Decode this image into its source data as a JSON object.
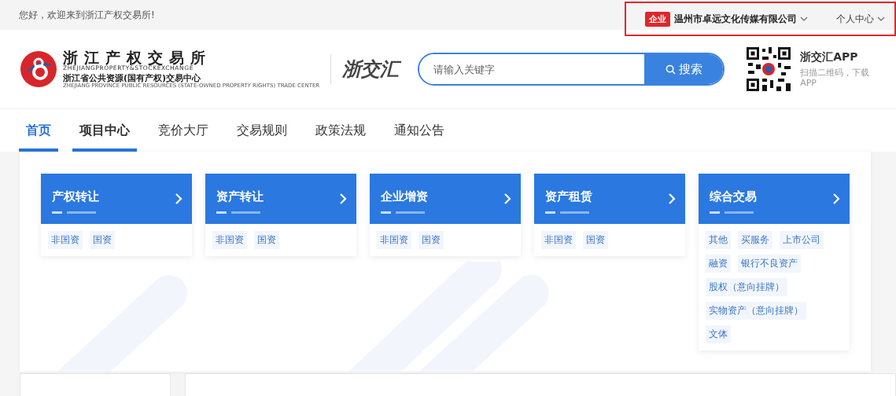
{
  "top_bar": {
    "greeting": "您好，欢迎来到浙江产权交易所!",
    "account_badge": "企业",
    "company": "温州市卓远文化传媒有限公司",
    "personal_center": "个人中心",
    "highlighted": true
  },
  "header": {
    "logo_title": "浙江产权交易所",
    "logo_en": "ZHEJIANGPROPERTY&STOCKEXCHANGE",
    "logo_subtitle": "浙江省公共资源(国有产权)交易中心",
    "logo_sub_en": "ZHEJIANG PROVINCE PUBLIC RESOURCES (STATE-OWNED PROPERTY RIGHTS) TRADE CENTER",
    "brand": "浙交汇",
    "search": {
      "placeholder": "请输入关键字",
      "button": "搜索"
    },
    "app_title": "浙交汇APP",
    "app_hint": "扫描二维码，下载APP"
  },
  "nav": [
    {
      "label": "首页",
      "selected": true,
      "open": false
    },
    {
      "label": "项目中心",
      "selected": false,
      "open": true
    },
    {
      "label": "竞价大厅",
      "selected": false,
      "open": false
    },
    {
      "label": "交易规则",
      "selected": false,
      "open": false
    },
    {
      "label": "政策法规",
      "selected": false,
      "open": false
    },
    {
      "label": "通知公告",
      "selected": false,
      "open": false
    }
  ],
  "categories": [
    {
      "title": "产权转让",
      "tags": [
        "非国资",
        "国资"
      ]
    },
    {
      "title": "资产转让",
      "tags": [
        "非国资",
        "国资"
      ]
    },
    {
      "title": "企业增资",
      "tags": [
        "非国资",
        "国资"
      ]
    },
    {
      "title": "资产租赁",
      "tags": [
        "非国资",
        "国资"
      ]
    },
    {
      "title": "综合交易",
      "tags": [
        "其他",
        "买服务",
        "上市公司",
        "融资",
        "银行不良资产",
        "股权（意向挂牌）",
        "实物资产（意向挂牌）",
        "文体"
      ]
    }
  ]
}
